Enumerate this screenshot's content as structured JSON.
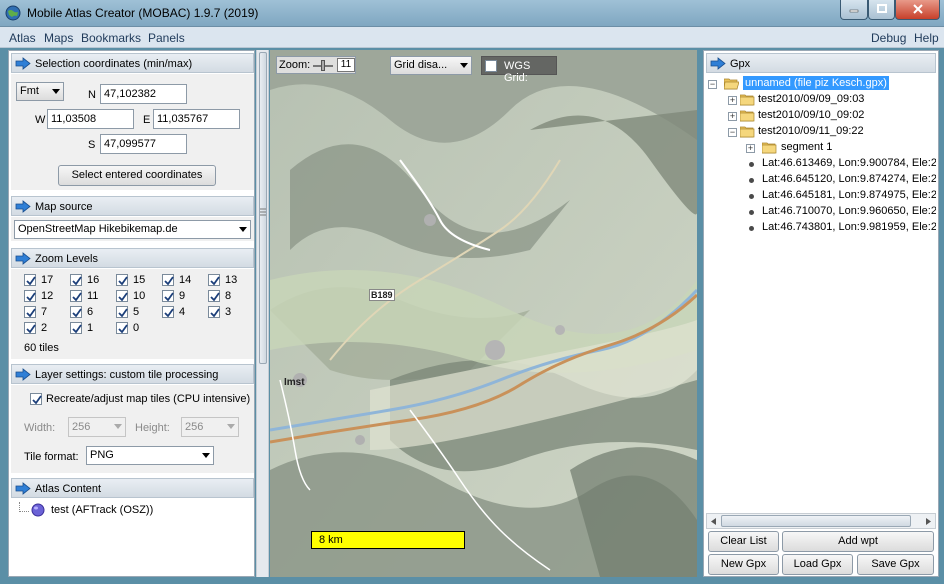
{
  "window": {
    "title": "Mobile Atlas Creator (MOBAC) 1.9.7 (2019)"
  },
  "menu": {
    "atlas": "Atlas",
    "maps": "Maps",
    "bookmarks": "Bookmarks",
    "panels": "Panels",
    "debug": "Debug",
    "help": "Help"
  },
  "selection": {
    "header": "Selection coordinates (min/max)",
    "format": "Fmt",
    "n_label": "N",
    "n_value": "47,102382",
    "w_label": "W",
    "w_value": "11,03508",
    "e_label": "E",
    "e_value": "11,035767",
    "s_label": "S",
    "s_value": "47,099577",
    "select_button": "Select entered coordinates"
  },
  "map_source": {
    "header": "Map source",
    "selected": "OpenStreetMap Hikebikemap.de"
  },
  "zoom_levels": {
    "header": "Zoom Levels",
    "levels": [
      "17",
      "16",
      "15",
      "14",
      "13",
      "12",
      "11",
      "10",
      "9",
      "8",
      "7",
      "6",
      "5",
      "4",
      "3",
      "2",
      "1",
      "0"
    ],
    "tiles": "60 tiles"
  },
  "layer_settings": {
    "header": "Layer settings: custom tile processing",
    "recreate_label": "Recreate/adjust map tiles (CPU intensive)",
    "width_label": "Width:",
    "width_value": "256",
    "height_label": "Height:",
    "height_value": "256",
    "format_label": "Tile format:",
    "format_value": "PNG"
  },
  "atlas_content": {
    "header": "Atlas Content",
    "item": "test (AFTrack (OSZ))"
  },
  "map": {
    "zoom_label": "Zoom:",
    "zoom_value": "11",
    "grid_select": "Grid disa...",
    "wgs_grid": "WGS Grid:",
    "scale": "8 km",
    "label_imst": "Imst",
    "label_b189": "B189"
  },
  "gpx": {
    "header": "Gpx",
    "root": "unnamed (file piz Kesch.gpx)",
    "tracks": [
      "test2010/09/09_09:03",
      "test2010/09/10_09:02",
      "test2010/09/11_09:22"
    ],
    "segment": "segment 1",
    "points": [
      "Lat:46.613469, Lon:9.900784, Ele:2",
      "Lat:46.645120, Lon:9.874274, Ele:2",
      "Lat:46.645181, Lon:9.874975, Ele:2",
      "Lat:46.710070, Lon:9.960650, Ele:2",
      "Lat:46.743801, Lon:9.981959, Ele:2"
    ],
    "buttons": {
      "clear_list": "Clear List",
      "add_wpt": "Add wpt",
      "new_gpx": "New Gpx",
      "load_gpx": "Load Gpx",
      "save_gpx": "Save Gpx"
    }
  }
}
